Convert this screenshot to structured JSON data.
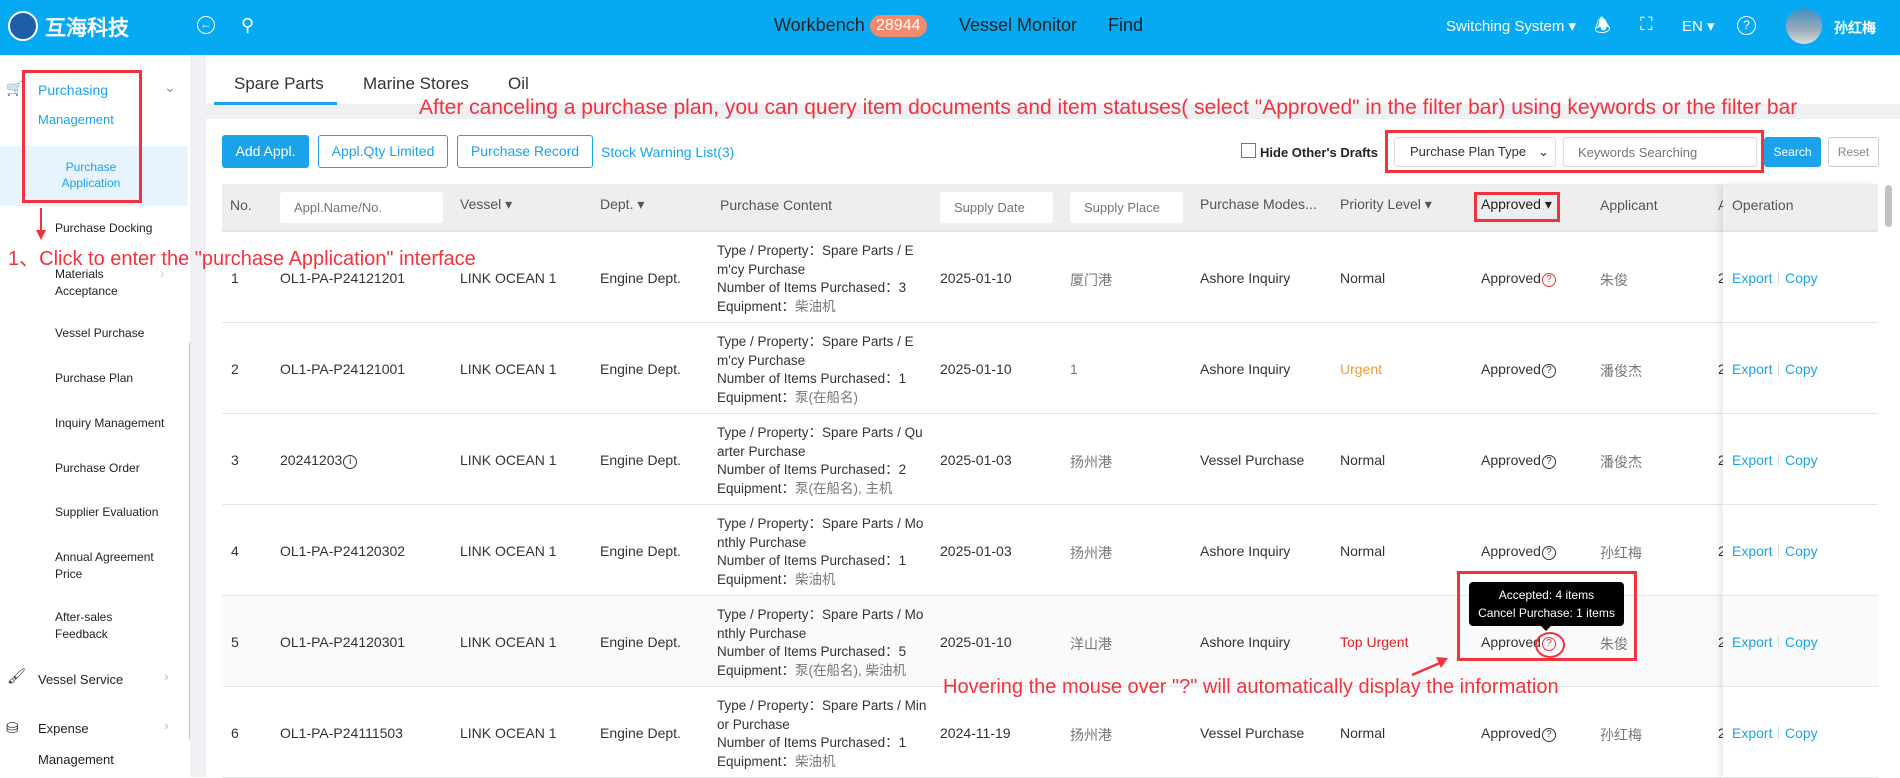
{
  "header": {
    "logo_text": "互海科技",
    "nav": [
      {
        "label": "Workbench",
        "badge": "28944"
      },
      {
        "label": "Vessel Monitor"
      },
      {
        "label": "Find"
      }
    ],
    "switching": "Switching System",
    "lang": "EN",
    "user": "孙红梅"
  },
  "sidebar": {
    "group": "Purchasing",
    "group2": "Management",
    "items": [
      "Purchase Application",
      "Purchase Docking",
      "Materials Acceptance",
      "Vessel Purchase",
      "Purchase Plan",
      "Inquiry Management",
      "Purchase Order",
      "Supplier Evaluation",
      "Annual Agreement Price",
      "After-sales Feedback"
    ],
    "vessel_service": "Vessel Service",
    "expense": "Expense",
    "expense2": "Management"
  },
  "tabs": [
    "Spare Parts",
    "Marine Stores",
    "Oil"
  ],
  "toolbar": {
    "add": "Add Appl.",
    "qty": "Appl.Qty Limited",
    "record": "Purchase Record",
    "stock": "Stock Warning List(3)",
    "hide": "Hide Other's Drafts",
    "plan_type": "Purchase Plan Type",
    "keyword_placeholder": "Keywords Searching",
    "search": "Search",
    "reset": "Reset"
  },
  "table": {
    "headers": {
      "no": "No.",
      "name_placeholder": "Appl.Name/No.",
      "vessel": "Vessel",
      "dept": "Dept.",
      "content": "Purchase Content",
      "date_placeholder": "Supply Date",
      "place_placeholder": "Supply Place",
      "mode": "Purchase Modes...",
      "priority": "Priority Level",
      "status": "Approved",
      "applicant": "Applicant",
      "hidden": "A",
      "operation": "Operation"
    },
    "labels": {
      "type": "Type / Property：",
      "num": "Number of Items Purchased：",
      "equip": "Equipment："
    },
    "export": "Export",
    "copy": "Copy",
    "rows": [
      {
        "no": "1",
        "name": "OL1-PA-P24121201",
        "vessel": "LINK OCEAN 1",
        "dept": "Engine Dept.",
        "type": "Spare Parts / Em'cy Purchase",
        "num": "3",
        "equip": "柴油机",
        "date": "2025-01-10",
        "place": "厦门港",
        "mode": "Ashore Inquiry",
        "priority": "Normal",
        "status": "Approved",
        "applicant": "朱俊",
        "hidden": "2"
      },
      {
        "no": "2",
        "name": "OL1-PA-P24121001",
        "vessel": "LINK OCEAN 1",
        "dept": "Engine Dept.",
        "type": "Spare Parts / Em'cy Purchase",
        "num": "1",
        "equip": "泵(在船名)",
        "date": "2025-01-10",
        "place": "1",
        "mode": "Ashore Inquiry",
        "priority": "Urgent",
        "status": "Approved",
        "applicant": "潘俊杰",
        "hidden": "2"
      },
      {
        "no": "3",
        "name": "20241203",
        "vessel": "LINK OCEAN 1",
        "dept": "Engine Dept.",
        "type": "Spare Parts / Quarter Purchase",
        "num": "2",
        "equip": "泵(在船名), 主机",
        "date": "2025-01-03",
        "place": "扬州港",
        "mode": "Vessel Purchase",
        "priority": "Normal",
        "status": "Approved",
        "applicant": "潘俊杰",
        "hidden": "2"
      },
      {
        "no": "4",
        "name": "OL1-PA-P24120302",
        "vessel": "LINK OCEAN 1",
        "dept": "Engine Dept.",
        "type": "Spare Parts / Monthly Purchase",
        "num": "1",
        "equip": "柴油机",
        "date": "2025-01-03",
        "place": "扬州港",
        "mode": "Ashore Inquiry",
        "priority": "Normal",
        "status": "Approved",
        "applicant": "孙红梅",
        "hidden": "2"
      },
      {
        "no": "5",
        "name": "OL1-PA-P24120301",
        "vessel": "LINK OCEAN 1",
        "dept": "Engine Dept.",
        "type": "Spare Parts / Monthly Purchase",
        "num": "5",
        "equip": "泵(在船名), 柴油机",
        "date": "2025-01-10",
        "place": "洋山港",
        "mode": "Ashore Inquiry",
        "priority": "Top Urgent",
        "status": "Approved",
        "applicant": "朱俊",
        "hidden": "2"
      },
      {
        "no": "6",
        "name": "OL1-PA-P24111503",
        "vessel": "LINK OCEAN 1",
        "dept": "Engine Dept.",
        "type": "Spare Parts / Minor Purchase",
        "num": "1",
        "equip": "柴油机",
        "date": "2024-11-19",
        "place": "扬州港",
        "mode": "Vessel Purchase",
        "priority": "Normal",
        "status": "Approved",
        "applicant": "孙红梅",
        "hidden": "2"
      }
    ]
  },
  "tooltip": {
    "line1": "Accepted: 4 items",
    "line2": "Cancel Purchase: 1 items"
  },
  "annotations": {
    "top": "After canceling a purchase plan, you can query item documents and item statuses( select \"Approved\" in the filter bar) using keywords or the filter bar",
    "left": "1、Click to enter the \"purchase Application\" interface",
    "bottom": "Hovering the mouse over \"?\" will automatically display the information"
  },
  "colors": {
    "header": "#06aaf2",
    "accent": "#1aa3ea",
    "urgent": "#f39c32",
    "top_urgent": "#e0201f",
    "annotation": "#f2323c",
    "badge": "#f4896b"
  }
}
